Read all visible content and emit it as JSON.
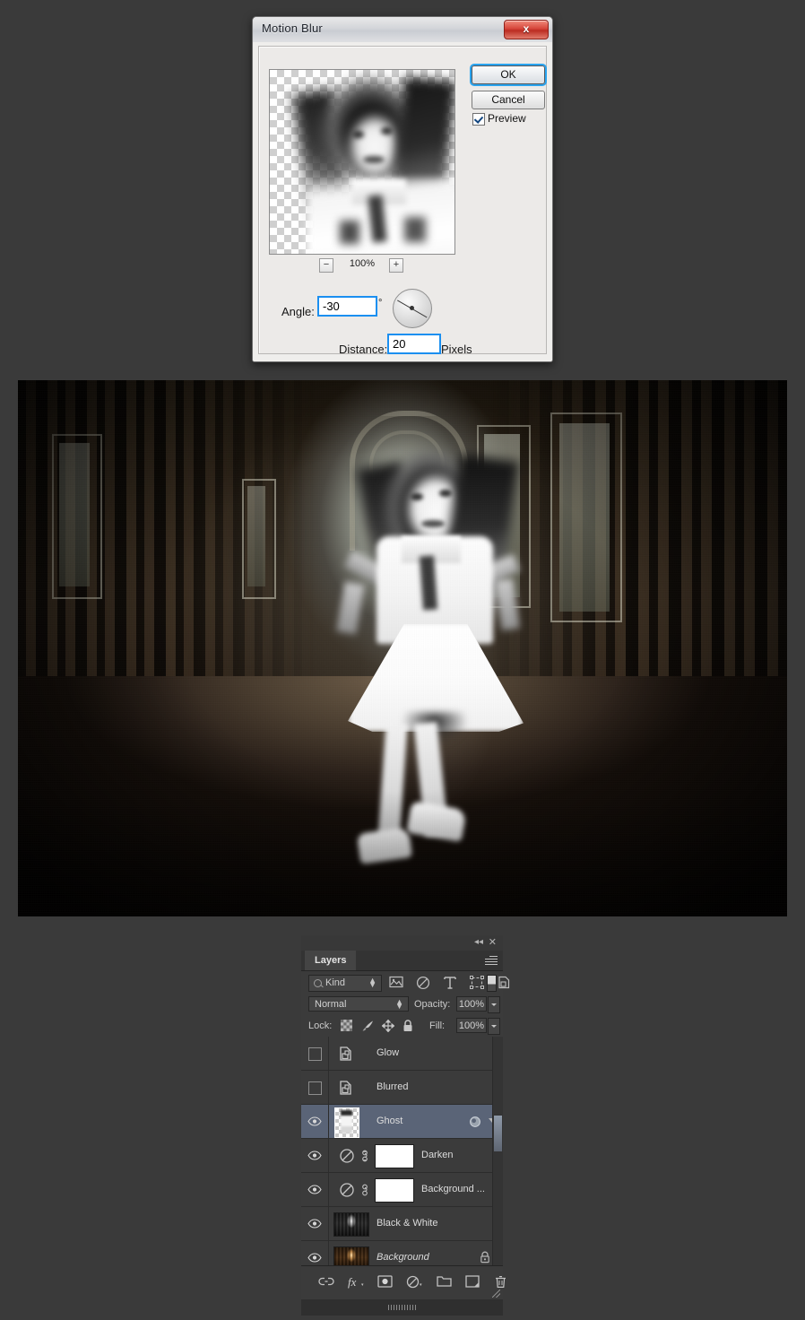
{
  "dialog": {
    "title": "Motion Blur",
    "close_label": "x",
    "ok_label": "OK",
    "cancel_label": "Cancel",
    "preview_label": "Preview",
    "zoom_percent": "100%",
    "zoom_out_label": "−",
    "zoom_in_label": "+",
    "angle_label": "Angle:",
    "angle_value": "-30",
    "angle_unit": "°",
    "distance_label": "Distance:",
    "distance_value": "20",
    "distance_unit": "Pixels",
    "accent_color": "#1b8ff0",
    "close_color": "#c9372b"
  },
  "layers_panel": {
    "tab_label": "Layers",
    "collapse_icon": "◂◂",
    "close_icon": "✕",
    "filter": {
      "search_icon": "search-icon",
      "kind_label": "Kind",
      "icons": [
        "pixel-layer-icon",
        "adjustment-layer-icon",
        "type-layer-icon",
        "shape-layer-icon",
        "smart-object-icon"
      ],
      "toggle_label": "filter-toggle"
    },
    "blend": {
      "mode": "Normal",
      "opacity_label": "Opacity:",
      "opacity_value": "100%"
    },
    "lock": {
      "label": "Lock:",
      "icons": [
        "lock-transparent-pixels-icon",
        "lock-image-pixels-icon",
        "lock-position-icon",
        "lock-all-icon"
      ],
      "fill_label": "Fill:",
      "fill_value": "100%"
    },
    "rows": [
      {
        "name": "Glow",
        "visible": false,
        "selected": false,
        "type": "smart-object",
        "locked": false
      },
      {
        "name": "Blurred",
        "visible": false,
        "selected": false,
        "type": "smart-object",
        "locked": false
      },
      {
        "name": "Ghost",
        "visible": true,
        "selected": true,
        "type": "smart-object-thumb",
        "locked": false
      },
      {
        "name": "Darken",
        "visible": true,
        "selected": false,
        "type": "adjustment",
        "locked": false
      },
      {
        "name": "Background ...",
        "visible": true,
        "selected": false,
        "type": "adjustment",
        "locked": false
      },
      {
        "name": "Black & White",
        "visible": true,
        "selected": false,
        "type": "image-bw",
        "locked": false
      },
      {
        "name": "Background",
        "visible": true,
        "selected": false,
        "type": "image-warm",
        "locked": true
      }
    ],
    "bottom_bar_icons": [
      "link-layers-icon",
      "layer-style-fx-icon",
      "add-layer-mask-icon",
      "new-adjustment-layer-icon",
      "new-group-icon",
      "new-layer-icon",
      "delete-layer-icon"
    ],
    "selection_color": "#5a6477",
    "panel_background": "#3b3b3b"
  },
  "canvas": {
    "description": "Dark abandoned corridor photograph with a motion-blurred ghostly girl in a white dress standing in the centre"
  }
}
